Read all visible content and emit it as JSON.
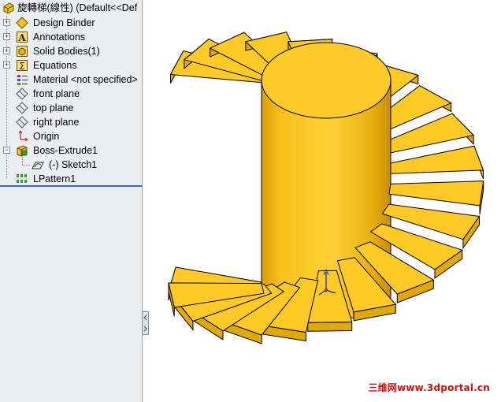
{
  "tree": {
    "root": "旋轉梯(線性)  (Default<<Def",
    "items": [
      {
        "label": "Design Binder",
        "icon": "design-binder-icon"
      },
      {
        "label": "Annotations",
        "icon": "annotations-icon"
      },
      {
        "label": "Solid Bodies(1)",
        "icon": "solid-bodies-icon"
      },
      {
        "label": "Equations",
        "icon": "equations-icon"
      },
      {
        "label": "Material <not specified>",
        "icon": "material-icon"
      },
      {
        "label": "front plane",
        "icon": "plane-icon"
      },
      {
        "label": "top plane",
        "icon": "plane-icon"
      },
      {
        "label": "right plane",
        "icon": "plane-icon"
      },
      {
        "label": "Origin",
        "icon": "origin-icon"
      },
      {
        "label": "Boss-Extrude1",
        "icon": "extrude-icon"
      },
      {
        "label": "(-) Sketch1",
        "icon": "sketch-icon"
      },
      {
        "label": "LPattern1",
        "icon": "linear-pattern-icon"
      }
    ]
  },
  "model": {
    "color": "#ffc926",
    "edge_color": "#000000",
    "steps_visible": 22
  },
  "watermark": "三维网www.3dportal.cn",
  "colors": {
    "panel": "#ebedf1",
    "rollback": "#3068c8",
    "watermark": "#d01010"
  }
}
